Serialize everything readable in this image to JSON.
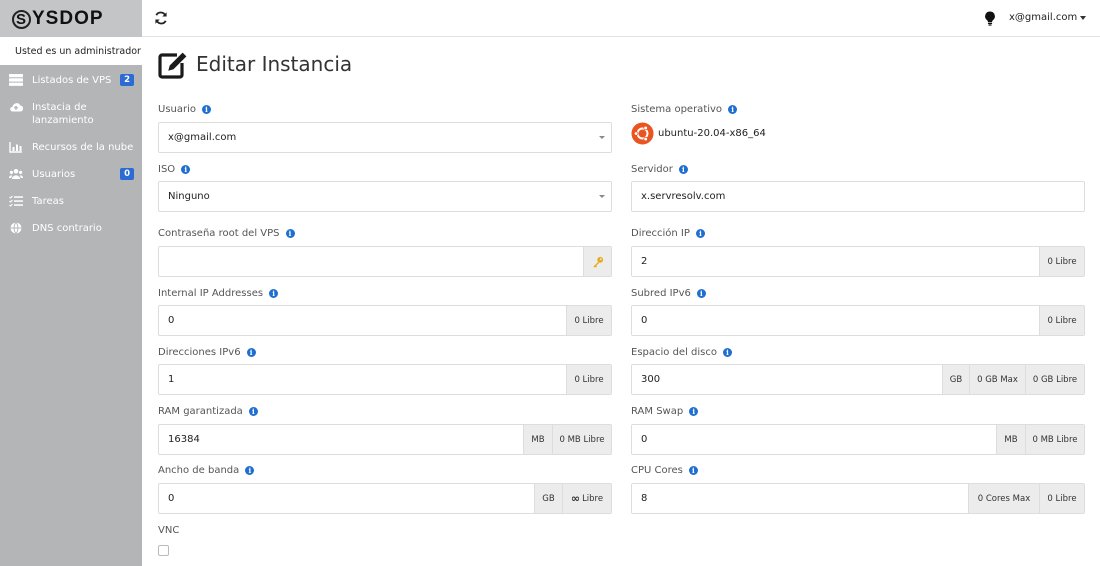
{
  "brand": {
    "rest": "YSDOP",
    "first_letter": "S"
  },
  "sidebar": {
    "admin_note": "Usted es un administrador",
    "items": [
      {
        "label": "Listados de VPS",
        "icon": "server-icon",
        "badge": "2"
      },
      {
        "label": "Instacia de lanzamiento",
        "icon": "cloud-upload-icon"
      },
      {
        "label": "Recursos de la nube",
        "icon": "bar-chart-icon"
      },
      {
        "label": "Usuarios",
        "icon": "users-icon",
        "badge": "0"
      },
      {
        "label": "Tareas",
        "icon": "tasks-icon"
      },
      {
        "label": "DNS contrario",
        "icon": "globe-icon"
      }
    ]
  },
  "topbar": {
    "user_email": "x@gmail.com"
  },
  "page": {
    "title": "Editar Instancia"
  },
  "form": {
    "usuario": {
      "label": "Usuario",
      "value": "x@gmail.com"
    },
    "sistema_operativo": {
      "label": "Sistema operativo",
      "value": "ubuntu-20.04-x86_64"
    },
    "iso": {
      "label": "ISO",
      "value": "Ninguno"
    },
    "servidor": {
      "label": "Servidor",
      "value": "x.servresolv.com"
    },
    "root_password": {
      "label": "Contraseña root del VPS",
      "value": ""
    },
    "direccion_ip": {
      "label": "Dirección IP",
      "value": "2",
      "free": "0 Libre"
    },
    "internal_ip": {
      "label": "Internal IP Addresses",
      "value": "0",
      "free": "0 Libre"
    },
    "subred_ipv6": {
      "label": "Subred IPv6",
      "value": "0",
      "free": "0 Libre"
    },
    "direcciones_ipv6": {
      "label": "Direcciones IPv6",
      "value": "1",
      "free": "0 Libre"
    },
    "espacio_disco": {
      "label": "Espacio del disco",
      "value": "300",
      "unit": "GB",
      "max": "0 GB Max",
      "free": "0 GB Libre"
    },
    "ram_garantizada": {
      "label": "RAM garantizada",
      "value": "16384",
      "unit": "MB",
      "free": "0 MB Libre"
    },
    "ram_swap": {
      "label": "RAM Swap",
      "value": "0",
      "unit": "MB",
      "free": "0 MB Libre"
    },
    "ancho_banda": {
      "label": "Ancho de banda",
      "value": "0",
      "unit": "GB",
      "free_symbol": "∞",
      "free": "Libre"
    },
    "cpu_cores": {
      "label": "CPU Cores",
      "value": "8",
      "max": "0 Cores Max",
      "free": "0 Libre"
    },
    "vnc": {
      "label": "VNC",
      "checked": false
    }
  }
}
